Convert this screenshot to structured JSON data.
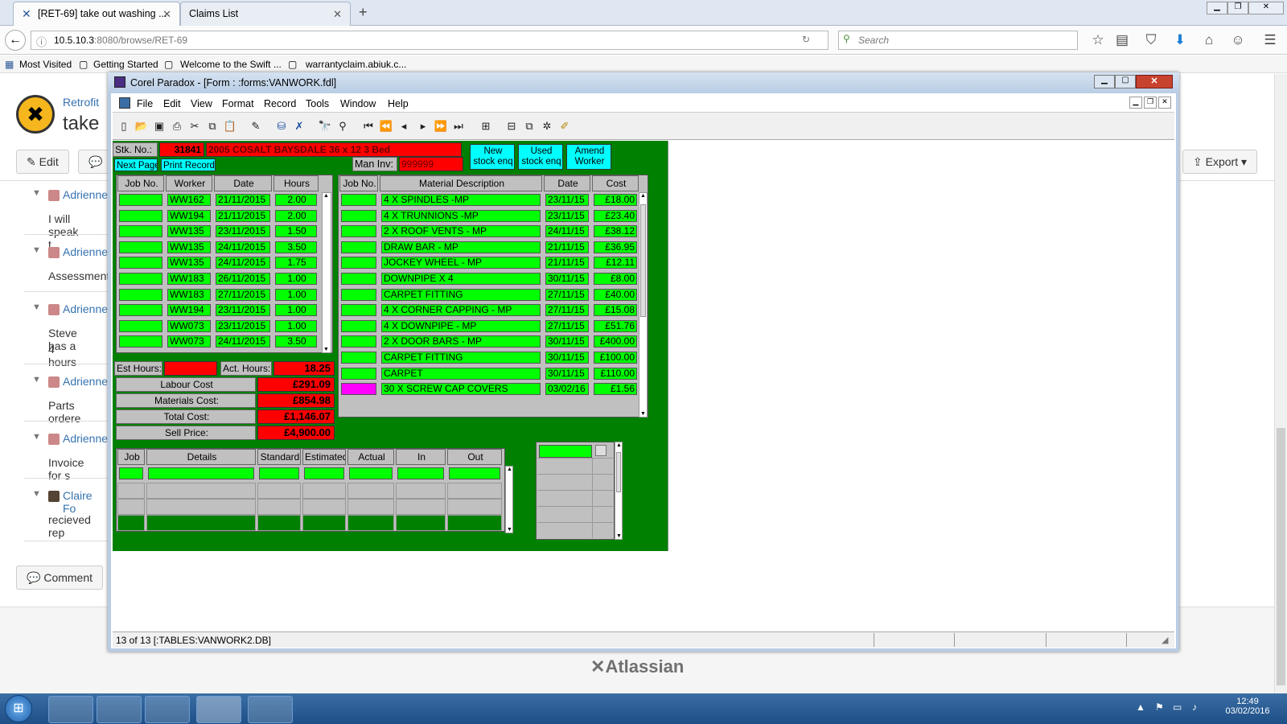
{
  "browser": {
    "tabs": [
      {
        "label": "[RET-69] take out washing ..."
      },
      {
        "label": "Claims List"
      }
    ],
    "url_host": "10.5.10.3",
    "url_rest": ":8080/browse/RET-69",
    "search_placeholder": "Search",
    "bookmarks": [
      "Most Visited",
      "Getting Started",
      "Welcome to the Swift ...",
      "warrantyclaim.abiuk.c..."
    ]
  },
  "jira": {
    "project": "Retrofit",
    "issue_title": "take",
    "edit_label": "Edit",
    "export_label": "Export",
    "comment_label": "Comment",
    "activity": [
      {
        "author": "Adrienne",
        "text": "I will speak t"
      },
      {
        "author": "Adrienne",
        "text": "Assessment"
      },
      {
        "author": "Adrienne",
        "text": "Steve has a",
        "text2": "4 hours"
      },
      {
        "author": "Adrienne",
        "text": "Parts ordere"
      },
      {
        "author": "Adrienne",
        "text": "Invoice for s"
      },
      {
        "author": "Claire Fo",
        "text": "recieved rep"
      }
    ],
    "footer_logo": "Atlassian"
  },
  "paradox": {
    "title": "Corel Paradox - [Form : :forms:VANWORK.fdl]",
    "menu": [
      "File",
      "Edit",
      "View",
      "Format",
      "Record",
      "Tools",
      "Window",
      "Help"
    ],
    "status": "13 of 13 [:TABLES:VANWORK2.DB]",
    "stk_label": "Stk. No.:",
    "stk_no": "31841",
    "stk_desc": "2005 COSALT BAYSDALE 36 x 12 3 Bed",
    "next_page": "Next Page",
    "print_record": "Print Record",
    "man_inv_label": "Man Inv:",
    "man_inv": "999999",
    "btn_new": [
      "New",
      "stock enq"
    ],
    "btn_used": [
      "Used",
      "stock enq"
    ],
    "btn_amend": [
      "Amend",
      "Worker"
    ],
    "labour_headers": [
      "Job No.",
      "Worker",
      "Date",
      "Hours"
    ],
    "labour_rows": [
      [
        "",
        "WW162",
        "21/11/2015",
        "2.00"
      ],
      [
        "",
        "WW194",
        "21/11/2015",
        "2.00"
      ],
      [
        "",
        "WW135",
        "23/11/2015",
        "1.50"
      ],
      [
        "",
        "WW135",
        "24/11/2015",
        "3.50"
      ],
      [
        "",
        "WW135",
        "24/11/2015",
        "1.75"
      ],
      [
        "",
        "WW183",
        "26/11/2015",
        "1.00"
      ],
      [
        "",
        "WW183",
        "27/11/2015",
        "1.00"
      ],
      [
        "",
        "WW194",
        "23/11/2015",
        "1.00"
      ],
      [
        "",
        "WW073",
        "23/11/2015",
        "1.00"
      ],
      [
        "",
        "WW073",
        "24/11/2015",
        "3.50"
      ]
    ],
    "material_headers": [
      "Job No.",
      "Material Description",
      "Date",
      "Cost"
    ],
    "material_rows": [
      [
        "",
        "4 X SPINDLES -MP",
        "23/11/15",
        "£18.00"
      ],
      [
        "",
        "4 X TRUNNIONS -MP",
        "23/11/15",
        "£23.40"
      ],
      [
        "",
        "2 X ROOF VENTS - MP",
        "24/11/15",
        "£38.12"
      ],
      [
        "",
        "DRAW BAR - MP",
        "21/11/15",
        "£36.95"
      ],
      [
        "",
        "JOCKEY WHEEL - MP",
        "21/11/15",
        "£12.11"
      ],
      [
        "",
        "DOWNPIPE X 4",
        "30/11/15",
        "£8.00"
      ],
      [
        "",
        "CARPET FITTING",
        "27/11/15",
        "£40.00"
      ],
      [
        "",
        "4 X CORNER CAPPING - MP",
        "27/11/15",
        "£15.08"
      ],
      [
        "",
        "4 X DOWNPIPE - MP",
        "27/11/15",
        "£51.76"
      ],
      [
        "",
        "2 X DOOR BARS - MP",
        "30/11/15",
        "£400.00"
      ],
      [
        "",
        "CARPET FITTING",
        "30/11/15",
        "£100.00"
      ],
      [
        "",
        "CARPET",
        "30/11/15",
        "£110.00"
      ],
      [
        "",
        "30 X SCREW CAP COVERS",
        "03/02/16",
        "£1.56"
      ]
    ],
    "est_hours_label": "Est Hours:",
    "act_hours_label": "Act. Hours:",
    "act_hours": "18.25",
    "labour_cost_label": "Labour Cost",
    "labour_cost": "£291.09",
    "materials_cost_label": "Materials Cost:",
    "materials_cost": "£854.98",
    "total_cost_label": "Total Cost:",
    "total_cost": "£1,146.07",
    "sell_price_label": "Sell Price:",
    "sell_price": "£4,900.00",
    "job_headers": [
      "Job",
      "Details",
      "Standard",
      "Estimated",
      "Actual",
      "In",
      "Out"
    ]
  },
  "taskbar": {
    "time": "12:49",
    "date": "03/02/2016"
  }
}
